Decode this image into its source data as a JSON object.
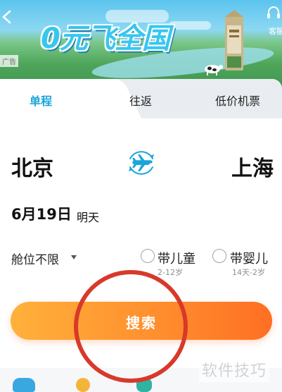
{
  "banner": {
    "headline": "0元飞全国",
    "ad_tag": "广告",
    "service_label": "客服"
  },
  "tabs": [
    {
      "label": "单程",
      "active": true
    },
    {
      "label": "往返",
      "active": false
    },
    {
      "label": "低价机票",
      "active": false
    }
  ],
  "route": {
    "from": "北京",
    "to": "上海",
    "swap_icon": "airplane-icon"
  },
  "date": {
    "value": "6月19日",
    "relative": "明天"
  },
  "options": {
    "cabin": "舱位不限",
    "child": {
      "label": "带儿童",
      "age": "2-12岁",
      "checked": false
    },
    "infant": {
      "label": "带婴儿",
      "age": "14天-2岁",
      "checked": false
    }
  },
  "search": {
    "label": "搜索"
  },
  "watermark": "软件技巧",
  "colors": {
    "accent": "#1aa6d9",
    "search_start": "#ffb13b",
    "search_end": "#ff6f23",
    "annotation": "#d8392a"
  }
}
